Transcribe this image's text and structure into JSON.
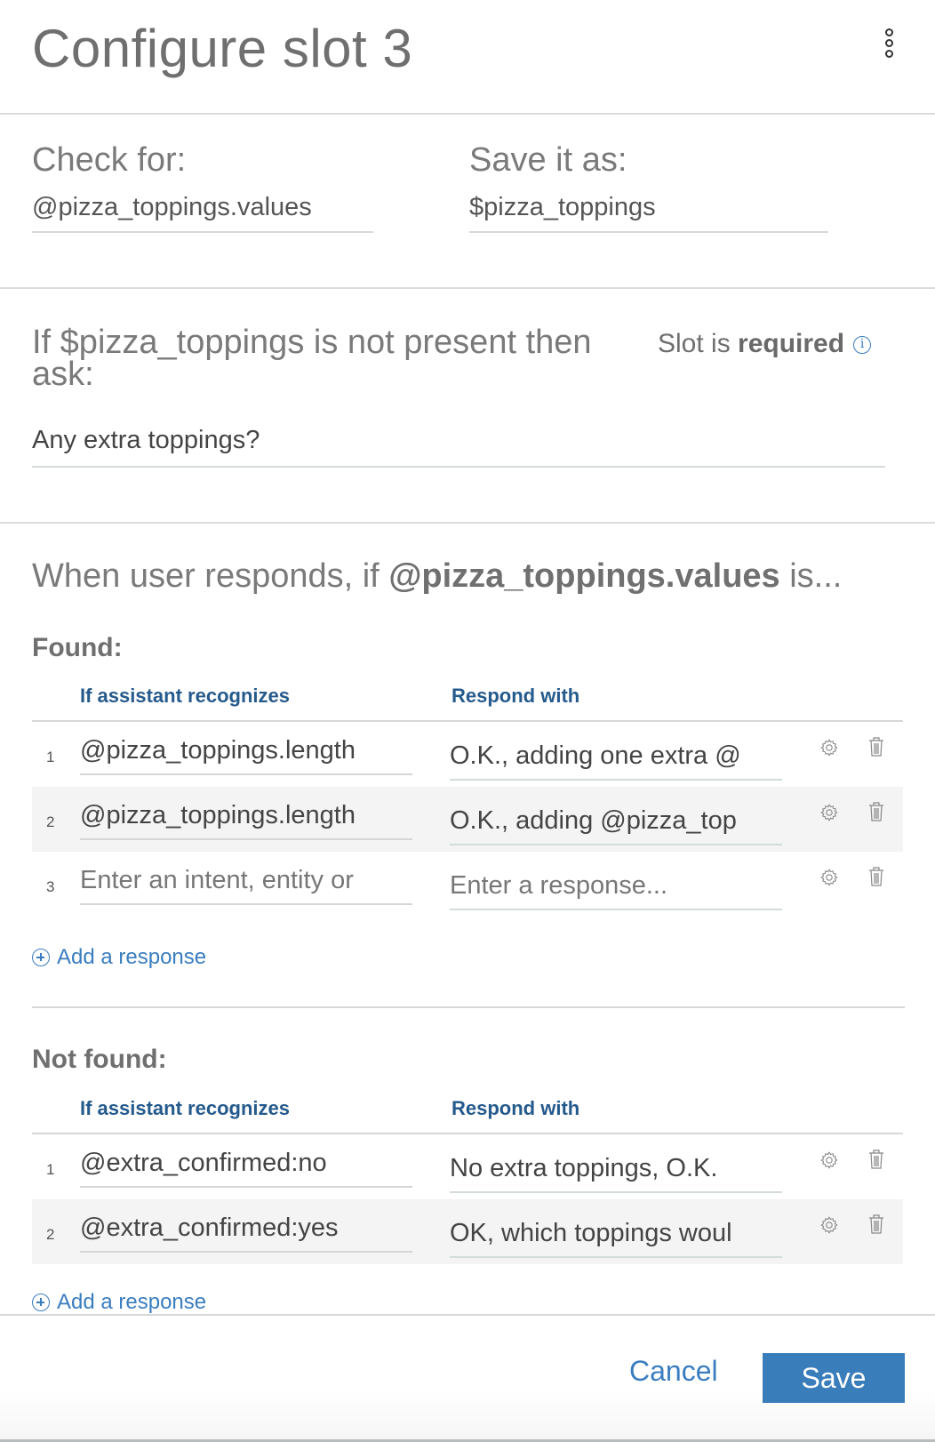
{
  "header": {
    "title": "Configure slot 3",
    "menu_icon": "overflow-menu-vertical-icon"
  },
  "check": {
    "check_for_label": "Check for:",
    "check_for_value": "@pizza_toppings.values",
    "save_as_label": "Save it as:",
    "save_as_value": "$pizza_toppings"
  },
  "ask": {
    "prompt_label": "If $pizza_toppings is not present then ask:",
    "required_prefix": "Slot is ",
    "required_bold": "required",
    "info_icon": "i",
    "question_value": "Any extra toppings?"
  },
  "responds": {
    "prefix": "When user responds, if ",
    "entity": "@pizza_toppings.values",
    "suffix": " is..."
  },
  "found": {
    "title": "Found:",
    "columns": [
      "If assistant recognizes",
      "Respond with"
    ],
    "rows": [
      {
        "num": "1",
        "condition": "@pizza_toppings.length",
        "response": "O.K., adding one extra @"
      },
      {
        "num": "2",
        "condition": "@pizza_toppings.length",
        "response": "O.K., adding @pizza_top"
      },
      {
        "num": "3",
        "condition_placeholder": "Enter an intent, entity or",
        "response_placeholder": "Enter a response..."
      }
    ],
    "add_label": "Add a response"
  },
  "not_found": {
    "title": "Not found:",
    "columns": [
      "If assistant recognizes",
      "Respond with"
    ],
    "rows": [
      {
        "num": "1",
        "condition": "@extra_confirmed:no",
        "response": "No extra toppings,  O.K."
      },
      {
        "num": "2",
        "condition": "@extra_confirmed:yes",
        "response": "OK, which toppings woul"
      }
    ],
    "add_label": "Add a response"
  },
  "footer": {
    "cancel_label": "Cancel",
    "save_label": "Save"
  },
  "colors": {
    "accent": "#3a7dbb",
    "header_text": "#255a8c"
  }
}
